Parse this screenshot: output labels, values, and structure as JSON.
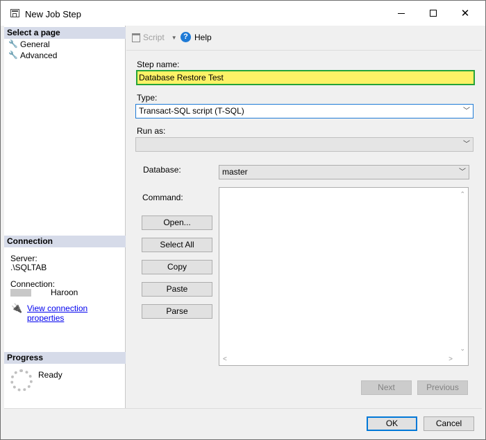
{
  "window": {
    "title": "New Job Step"
  },
  "left": {
    "select_page_header": "Select a page",
    "pages": [
      {
        "label": "General"
      },
      {
        "label": "Advanced"
      }
    ],
    "connection_header": "Connection",
    "server_label": "Server:",
    "server_value": ".\\SQLTAB",
    "connection_label": "Connection:",
    "connection_user": "Haroon",
    "view_properties_link": "View connection properties",
    "progress_header": "Progress",
    "progress_status": "Ready"
  },
  "toolbar": {
    "script_label": "Script",
    "help_label": "Help"
  },
  "form": {
    "step_name_label": "Step name:",
    "step_name_value": "Database Restore Test",
    "type_label": "Type:",
    "type_value": "Transact-SQL script (T-SQL)",
    "run_as_label": "Run as:",
    "run_as_value": "",
    "database_label": "Database:",
    "database_value": "master",
    "command_label": "Command:",
    "command_value": "",
    "buttons": {
      "open": "Open...",
      "select_all": "Select All",
      "copy": "Copy",
      "paste": "Paste",
      "parse": "Parse"
    },
    "next_label": "Next",
    "previous_label": "Previous"
  },
  "dialog": {
    "ok_label": "OK",
    "cancel_label": "Cancel"
  },
  "colors": {
    "highlight_fill": "#fdf266",
    "highlight_border": "#25a33a",
    "section_header": "#d6dbe9",
    "link": "#0000ee"
  }
}
